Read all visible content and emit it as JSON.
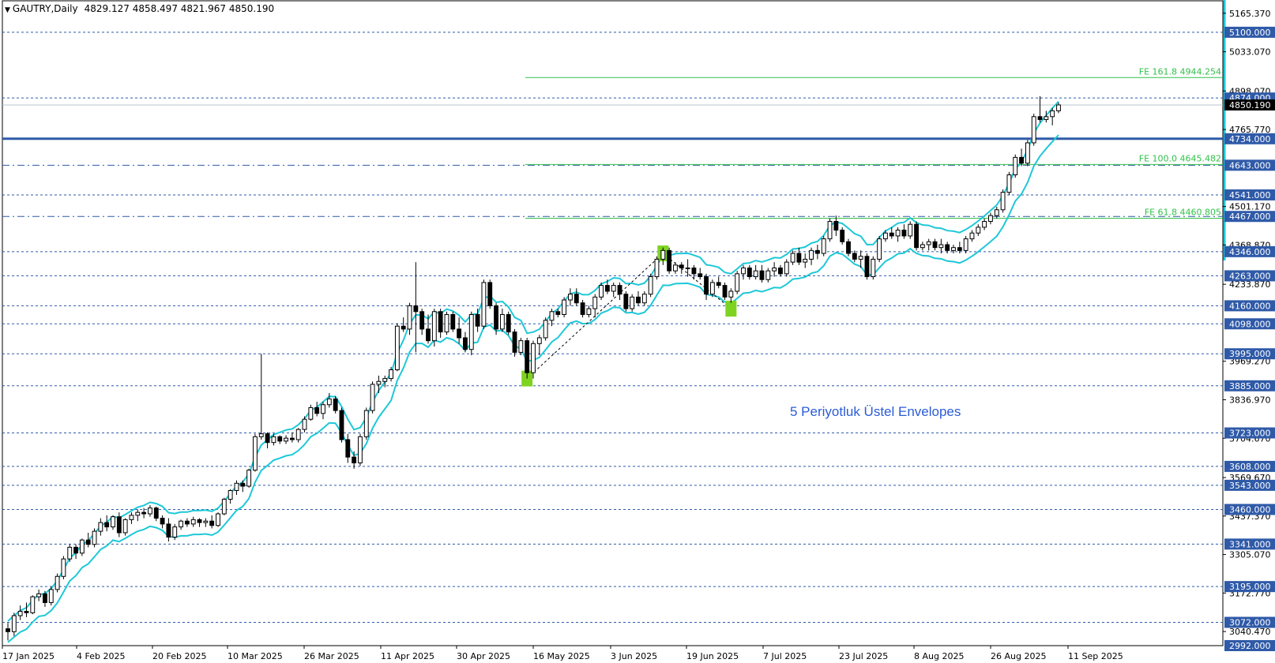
{
  "header": {
    "symbol": "GAUTRY,Daily",
    "ohlc": "4829.127 4858.497 4821.967 4850.190"
  },
  "annotation": "5 Periyotluk Üstel Envelopes",
  "colors": {
    "bull": "#ffffff",
    "bear": "#000000",
    "envelope": "#1ec8d8",
    "level": "#2f5aa8",
    "fib": "#31c24a",
    "signal": "#7ed321",
    "current_bg": "#000000"
  },
  "chart_data": {
    "type": "candlestick",
    "y_range": [
      2992,
      5200
    ],
    "y_ticks": [
      5165.37,
      5033.07,
      4898.07,
      4765.77,
      4501.17,
      4368.87,
      4233.87,
      3969.27,
      3836.97,
      3704.67,
      3569.67,
      3437.37,
      3305.07,
      3172.77,
      3040.47
    ],
    "x_labels": [
      "17 Jan 2025",
      "4 Feb 2025",
      "20 Feb 2025",
      "10 Mar 2025",
      "26 Mar 2025",
      "11 Apr 2025",
      "30 Apr 2025",
      "16 May 2025",
      "3 Jun 2025",
      "19 Jun 2025",
      "7 Jul 2025",
      "23 Jul 2025",
      "8 Aug 2025",
      "26 Aug 2025",
      "11 Sep 2025"
    ],
    "levels": [
      {
        "value": 5100.0,
        "label": "5100.000",
        "style": "dash"
      },
      {
        "value": 4874.0,
        "label": "4874.000",
        "style": "dash"
      },
      {
        "value": 4734.0,
        "label": "4734.000",
        "style": "solid-thick"
      },
      {
        "value": 4643.0,
        "label": "4643.000",
        "style": "dashdot"
      },
      {
        "value": 4541.0,
        "label": "4541.000",
        "style": "dash"
      },
      {
        "value": 4467.0,
        "label": "4467.000",
        "style": "dashdot"
      },
      {
        "value": 4346.0,
        "label": "4346.000",
        "style": "dash"
      },
      {
        "value": 4263.0,
        "label": "4263.000",
        "style": "dash"
      },
      {
        "value": 4160.0,
        "label": "4160.000",
        "style": "dash"
      },
      {
        "value": 4098.0,
        "label": "4098.000",
        "style": "dash"
      },
      {
        "value": 3995.0,
        "label": "3995.000",
        "style": "dash"
      },
      {
        "value": 3885.0,
        "label": "3885.000",
        "style": "dash"
      },
      {
        "value": 3723.0,
        "label": "3723.000",
        "style": "dash"
      },
      {
        "value": 3608.0,
        "label": "3608.000",
        "style": "dash"
      },
      {
        "value": 3543.0,
        "label": "3543.000",
        "style": "dash"
      },
      {
        "value": 3460.0,
        "label": "3460.000",
        "style": "dash"
      },
      {
        "value": 3341.0,
        "label": "3341.000",
        "style": "dash"
      },
      {
        "value": 3195.0,
        "label": "3195.000",
        "style": "dash"
      },
      {
        "value": 3072.0,
        "label": "3072.000",
        "style": "dash"
      },
      {
        "value": 2992.0,
        "label": "2992.000",
        "style": "none"
      }
    ],
    "fib": [
      {
        "value": 4944.254,
        "label": "FE 161.8 4944.254"
      },
      {
        "value": 4645.482,
        "label": "FE 100.0 4645.482"
      },
      {
        "value": 4460.805,
        "label": "FE 61.8 4460.805"
      }
    ],
    "current_price": {
      "value": 4850.19,
      "label": "4850.190"
    },
    "candles": [
      [
        3050,
        3070,
        3010,
        3040
      ],
      [
        3040,
        3105,
        3025,
        3095
      ],
      [
        3095,
        3130,
        3080,
        3110
      ],
      [
        3110,
        3140,
        3090,
        3105
      ],
      [
        3105,
        3165,
        3100,
        3160
      ],
      [
        3160,
        3185,
        3145,
        3170
      ],
      [
        3170,
        3180,
        3125,
        3140
      ],
      [
        3140,
        3195,
        3130,
        3185
      ],
      [
        3185,
        3240,
        3175,
        3230
      ],
      [
        3230,
        3300,
        3220,
        3290
      ],
      [
        3290,
        3340,
        3280,
        3330
      ],
      [
        3330,
        3340,
        3290,
        3310
      ],
      [
        3310,
        3360,
        3300,
        3355
      ],
      [
        3355,
        3380,
        3330,
        3340
      ],
      [
        3340,
        3395,
        3330,
        3385
      ],
      [
        3385,
        3430,
        3370,
        3415
      ],
      [
        3415,
        3440,
        3385,
        3400
      ],
      [
        3400,
        3440,
        3390,
        3435
      ],
      [
        3435,
        3450,
        3365,
        3380
      ],
      [
        3380,
        3430,
        3370,
        3425
      ],
      [
        3425,
        3450,
        3410,
        3440
      ],
      [
        3440,
        3460,
        3420,
        3450
      ],
      [
        3450,
        3465,
        3430,
        3445
      ],
      [
        3445,
        3475,
        3435,
        3465
      ],
      [
        3465,
        3470,
        3420,
        3430
      ],
      [
        3430,
        3440,
        3395,
        3410
      ],
      [
        3410,
        3430,
        3350,
        3365
      ],
      [
        3365,
        3410,
        3355,
        3400
      ],
      [
        3400,
        3425,
        3390,
        3420
      ],
      [
        3420,
        3430,
        3400,
        3410
      ],
      [
        3410,
        3435,
        3400,
        3425
      ],
      [
        3425,
        3430,
        3400,
        3415
      ],
      [
        3415,
        3430,
        3400,
        3420
      ],
      [
        3420,
        3440,
        3395,
        3405
      ],
      [
        3405,
        3450,
        3400,
        3445
      ],
      [
        3445,
        3500,
        3440,
        3495
      ],
      [
        3495,
        3530,
        3480,
        3525
      ],
      [
        3525,
        3560,
        3510,
        3550
      ],
      [
        3550,
        3560,
        3520,
        3540
      ],
      [
        3540,
        3600,
        3535,
        3595
      ],
      [
        3595,
        3720,
        3590,
        3710
      ],
      [
        3710,
        3995,
        3700,
        3720
      ],
      [
        3720,
        3725,
        3670,
        3690
      ],
      [
        3690,
        3720,
        3680,
        3710
      ],
      [
        3710,
        3715,
        3685,
        3695
      ],
      [
        3695,
        3715,
        3685,
        3705
      ],
      [
        3705,
        3725,
        3690,
        3700
      ],
      [
        3700,
        3740,
        3690,
        3735
      ],
      [
        3735,
        3780,
        3725,
        3770
      ],
      [
        3770,
        3820,
        3765,
        3810
      ],
      [
        3810,
        3830,
        3780,
        3790
      ],
      [
        3790,
        3830,
        3770,
        3820
      ],
      [
        3820,
        3860,
        3810,
        3840
      ],
      [
        3840,
        3850,
        3790,
        3800
      ],
      [
        3800,
        3810,
        3690,
        3700
      ],
      [
        3700,
        3720,
        3620,
        3640
      ],
      [
        3640,
        3660,
        3600,
        3620
      ],
      [
        3620,
        3720,
        3610,
        3710
      ],
      [
        3710,
        3810,
        3700,
        3800
      ],
      [
        3800,
        3900,
        3790,
        3890
      ],
      [
        3890,
        3920,
        3860,
        3900
      ],
      [
        3900,
        3920,
        3880,
        3910
      ],
      [
        3910,
        3950,
        3900,
        3940
      ],
      [
        3940,
        4100,
        3935,
        4090
      ],
      [
        4090,
        4120,
        4070,
        4080
      ],
      [
        4080,
        4170,
        4060,
        4160
      ],
      [
        4160,
        4310,
        4000,
        4140
      ],
      [
        4140,
        4150,
        4060,
        4080
      ],
      [
        4080,
        4130,
        4030,
        4040
      ],
      [
        4040,
        4150,
        4020,
        4140
      ],
      [
        4140,
        4150,
        4050,
        4070
      ],
      [
        4070,
        4140,
        4060,
        4130
      ],
      [
        4130,
        4140,
        4070,
        4080
      ],
      [
        4080,
        4120,
        4030,
        4050
      ],
      [
        4050,
        4070,
        4000,
        4010
      ],
      [
        4010,
        4140,
        3990,
        4130
      ],
      [
        4130,
        4150,
        4070,
        4090
      ],
      [
        4090,
        4250,
        4080,
        4240
      ],
      [
        4240,
        4250,
        4150,
        4160
      ],
      [
        4160,
        4170,
        4060,
        4080
      ],
      [
        4080,
        4150,
        4070,
        4130
      ],
      [
        4130,
        4140,
        4060,
        4070
      ],
      [
        4070,
        4080,
        3985,
        4000
      ],
      [
        4000,
        4050,
        3990,
        4040
      ],
      [
        4040,
        4050,
        3910,
        3930
      ],
      [
        3930,
        4040,
        3910,
        4030
      ],
      [
        4030,
        4060,
        3990,
        4050
      ],
      [
        4050,
        4120,
        4040,
        4110
      ],
      [
        4110,
        4150,
        4090,
        4140
      ],
      [
        4140,
        4150,
        4120,
        4130
      ],
      [
        4130,
        4190,
        4120,
        4180
      ],
      [
        4180,
        4220,
        4160,
        4200
      ],
      [
        4200,
        4220,
        4160,
        4170
      ],
      [
        4170,
        4180,
        4120,
        4130
      ],
      [
        4130,
        4160,
        4120,
        4150
      ],
      [
        4150,
        4200,
        4120,
        4190
      ],
      [
        4190,
        4240,
        4180,
        4230
      ],
      [
        4230,
        4250,
        4200,
        4210
      ],
      [
        4210,
        4240,
        4190,
        4230
      ],
      [
        4230,
        4240,
        4180,
        4200
      ],
      [
        4200,
        4210,
        4140,
        4150
      ],
      [
        4150,
        4200,
        4140,
        4190
      ],
      [
        4190,
        4210,
        4160,
        4170
      ],
      [
        4170,
        4210,
        4160,
        4200
      ],
      [
        4200,
        4270,
        4190,
        4260
      ],
      [
        4260,
        4330,
        4250,
        4320
      ],
      [
        4320,
        4360,
        4300,
        4350
      ],
      [
        4350,
        4360,
        4270,
        4280
      ],
      [
        4280,
        4310,
        4270,
        4300
      ],
      [
        4300,
        4310,
        4270,
        4290
      ],
      [
        4290,
        4320,
        4260,
        4290
      ],
      [
        4290,
        4300,
        4250,
        4270
      ],
      [
        4270,
        4290,
        4250,
        4260
      ],
      [
        4260,
        4270,
        4180,
        4200
      ],
      [
        4200,
        4250,
        4190,
        4240
      ],
      [
        4240,
        4260,
        4220,
        4230
      ],
      [
        4230,
        4240,
        4180,
        4190
      ],
      [
        4190,
        4220,
        4170,
        4210
      ],
      [
        4210,
        4280,
        4200,
        4270
      ],
      [
        4270,
        4300,
        4250,
        4290
      ],
      [
        4290,
        4300,
        4250,
        4260
      ],
      [
        4260,
        4300,
        4250,
        4280
      ],
      [
        4280,
        4300,
        4240,
        4250
      ],
      [
        4250,
        4290,
        4240,
        4280
      ],
      [
        4280,
        4310,
        4260,
        4290
      ],
      [
        4290,
        4300,
        4260,
        4270
      ],
      [
        4270,
        4320,
        4260,
        4310
      ],
      [
        4310,
        4350,
        4300,
        4340
      ],
      [
        4340,
        4360,
        4300,
        4310
      ],
      [
        4310,
        4340,
        4290,
        4320
      ],
      [
        4320,
        4360,
        4300,
        4350
      ],
      [
        4350,
        4370,
        4320,
        4340
      ],
      [
        4340,
        4400,
        4330,
        4390
      ],
      [
        4390,
        4460,
        4380,
        4450
      ],
      [
        4450,
        4470,
        4400,
        4420
      ],
      [
        4420,
        4430,
        4370,
        4380
      ],
      [
        4380,
        4390,
        4330,
        4340
      ],
      [
        4340,
        4350,
        4310,
        4320
      ],
      [
        4320,
        4350,
        4290,
        4330
      ],
      [
        4330,
        4340,
        4250,
        4260
      ],
      [
        4260,
        4330,
        4250,
        4320
      ],
      [
        4320,
        4400,
        4310,
        4390
      ],
      [
        4390,
        4420,
        4380,
        4410
      ],
      [
        4410,
        4430,
        4390,
        4400
      ],
      [
        4400,
        4430,
        4380,
        4420
      ],
      [
        4420,
        4440,
        4390,
        4400
      ],
      [
        4400,
        4450,
        4390,
        4440
      ],
      [
        4440,
        4450,
        4350,
        4360
      ],
      [
        4360,
        4380,
        4350,
        4370
      ],
      [
        4370,
        4390,
        4350,
        4380
      ],
      [
        4380,
        4390,
        4350,
        4360
      ],
      [
        4360,
        4390,
        4340,
        4370
      ],
      [
        4370,
        4380,
        4340,
        4350
      ],
      [
        4350,
        4370,
        4340,
        4360
      ],
      [
        4360,
        4380,
        4340,
        4350
      ],
      [
        4350,
        4400,
        4340,
        4390
      ],
      [
        4390,
        4420,
        4380,
        4410
      ],
      [
        4410,
        4440,
        4400,
        4430
      ],
      [
        4430,
        4460,
        4420,
        4450
      ],
      [
        4450,
        4480,
        4440,
        4470
      ],
      [
        4470,
        4500,
        4460,
        4490
      ],
      [
        4490,
        4560,
        4480,
        4550
      ],
      [
        4550,
        4620,
        4540,
        4610
      ],
      [
        4610,
        4680,
        4600,
        4670
      ],
      [
        4670,
        4700,
        4640,
        4650
      ],
      [
        4650,
        4730,
        4640,
        4720
      ],
      [
        4720,
        4820,
        4710,
        4810
      ],
      [
        4810,
        4880,
        4790,
        4800
      ],
      [
        4800,
        4830,
        4790,
        4810
      ],
      [
        4810,
        4840,
        4780,
        4830
      ],
      [
        4830,
        4858.497,
        4821.967,
        4850.19
      ]
    ],
    "envelope_period": 5,
    "envelope_deviation_pct": 1.2,
    "signal_boxes": [
      {
        "candle": 84,
        "value": 3910
      },
      {
        "candle": 106,
        "value": 4340
      },
      {
        "candle": 117,
        "value": 4150
      }
    ]
  }
}
